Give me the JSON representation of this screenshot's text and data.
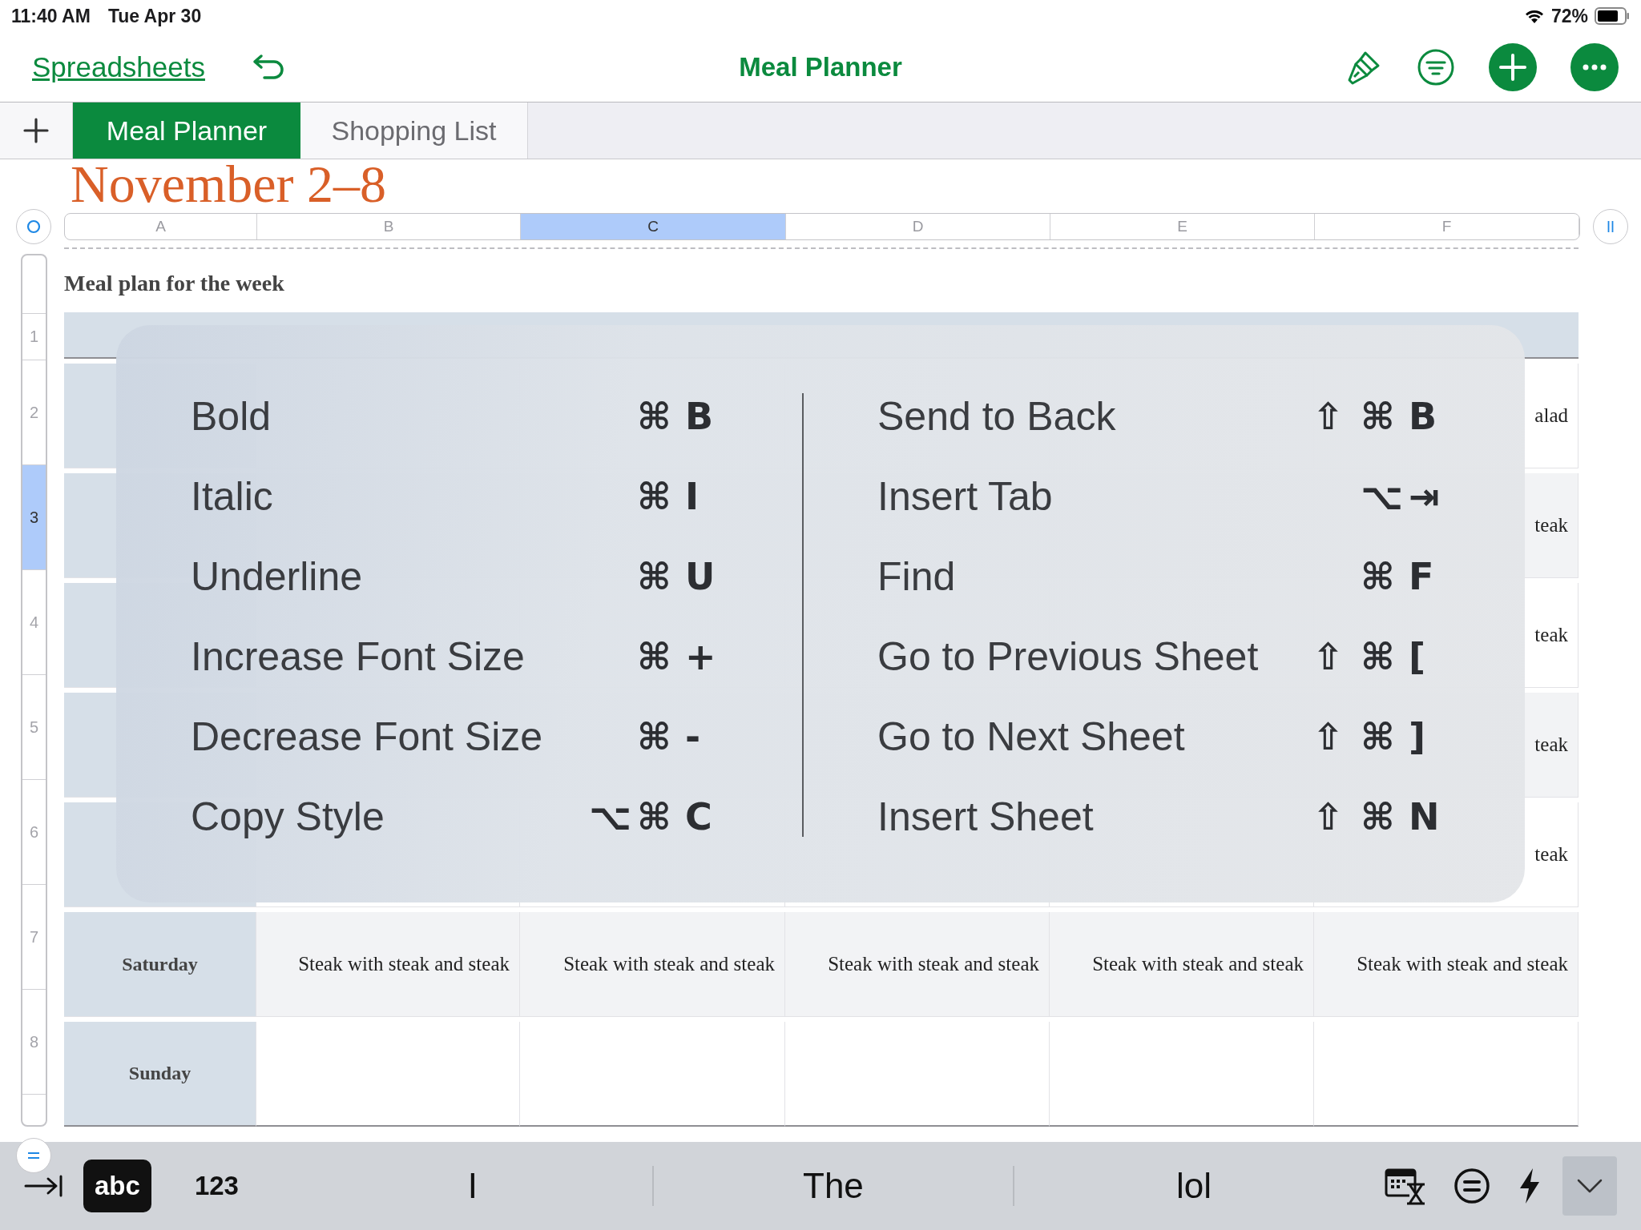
{
  "status_bar": {
    "time": "11:40 AM",
    "date": "Tue Apr 30",
    "battery": "72%"
  },
  "nav_bar": {
    "back": "Spreadsheets",
    "title": "Meal Planner"
  },
  "sheet_tabs": [
    {
      "label": "Meal Planner",
      "selected": true
    },
    {
      "label": "Shopping List",
      "selected": false
    }
  ],
  "sheet": {
    "title": "November 2–8",
    "caption": "Meal plan for the week",
    "columns": [
      {
        "label": "A",
        "selected": false
      },
      {
        "label": "B",
        "selected": false
      },
      {
        "label": "C",
        "selected": true
      },
      {
        "label": "D",
        "selected": false
      },
      {
        "label": "E",
        "selected": false
      },
      {
        "label": "F",
        "selected": false
      }
    ],
    "rows": [
      {
        "number": "1",
        "kind": "header",
        "selected": false
      },
      {
        "number": "2",
        "kind": "body",
        "selected": false,
        "f": "alad"
      },
      {
        "number": "3",
        "kind": "body",
        "selected": true,
        "f": "teak"
      },
      {
        "number": "4",
        "kind": "body",
        "selected": false,
        "f": "teak"
      },
      {
        "number": "5",
        "kind": "body",
        "selected": false,
        "f": "teak"
      },
      {
        "number": "6",
        "kind": "body",
        "selected": false,
        "f": "teak"
      },
      {
        "number": "7",
        "kind": "body",
        "selected": false,
        "a": "Saturday",
        "b": "Steak with steak and steak",
        "c": "Steak with steak and steak",
        "d": "Steak with steak and steak",
        "e": "Steak with steak and steak",
        "f": "Steak with steak and steak"
      },
      {
        "number": "8",
        "kind": "body",
        "selected": false,
        "a": "Sunday"
      }
    ]
  },
  "shortcuts_overlay": {
    "columns": [
      {
        "items": [
          {
            "label": "Bold",
            "keys": [
              "⌘",
              "B"
            ]
          },
          {
            "label": "Italic",
            "keys": [
              "⌘",
              "I"
            ]
          },
          {
            "label": "Underline",
            "keys": [
              "⌘",
              "U"
            ]
          },
          {
            "label": "Increase Font Size",
            "keys": [
              "⌘",
              "+"
            ]
          },
          {
            "label": "Decrease Font Size",
            "keys": [
              "⌘",
              "-"
            ]
          },
          {
            "label": "Copy Style",
            "keys": [
              "⌥",
              "⌘",
              "C"
            ]
          }
        ]
      },
      {
        "items": [
          {
            "label": "Send to Back",
            "keys": [
              "⇧",
              "⌘",
              "B"
            ]
          },
          {
            "label": "Insert Tab",
            "keys": [
              "⌥",
              "⇥"
            ]
          },
          {
            "label": "Find",
            "keys": [
              "⌘",
              "F"
            ]
          },
          {
            "label": "Go to Previous Sheet",
            "keys": [
              "⇧",
              "⌘",
              "["
            ]
          },
          {
            "label": "Go to Next Sheet",
            "keys": [
              "⇧",
              "⌘",
              "]"
            ]
          },
          {
            "label": "Insert Sheet",
            "keys": [
              "⇧",
              "⌘",
              "N"
            ]
          }
        ]
      }
    ]
  },
  "keyboard_bar": {
    "modes": [
      {
        "label": "abc",
        "selected": true
      },
      {
        "label": "123",
        "selected": false
      }
    ],
    "suggestions": [
      "I",
      "The",
      "lol"
    ]
  }
}
